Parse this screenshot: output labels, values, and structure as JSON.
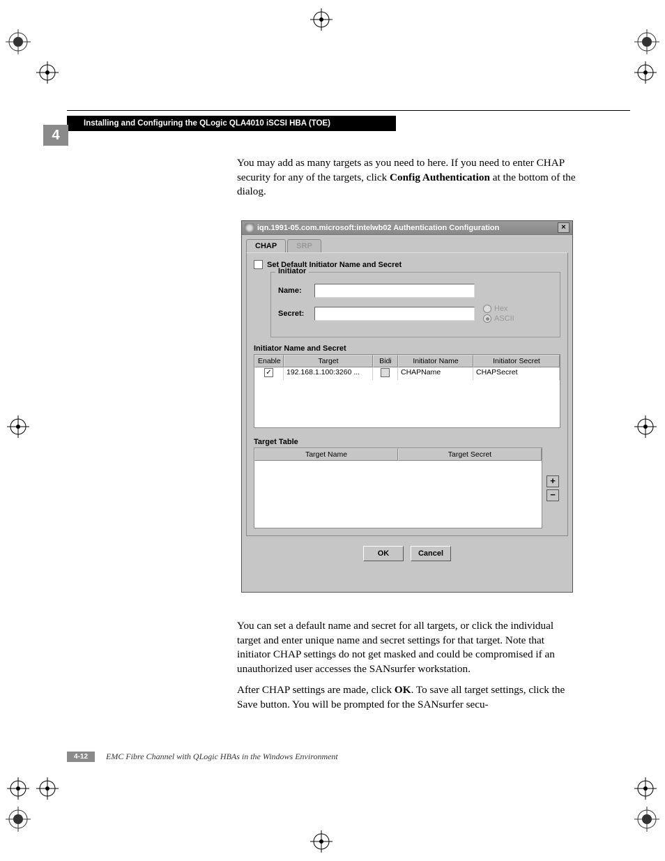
{
  "chapter_num": "4",
  "header_title": "Installing and Configuring the QLogic QLA4010 iSCSI HBA (TOE)",
  "para1_a": "You may add as many targets as you need to here.  If you need to enter CHAP security for any of the targets, click ",
  "para1_b": "Config Authentication",
  "para1_c": " at the bottom of the dialog.",
  "dialog": {
    "title": "iqn.1991-05.com.microsoft:intelwb02 Authentication Configuration",
    "tab_chap": "CHAP",
    "tab_srp": "SRP",
    "set_default_label": "Set Default Initiator Name and Secret",
    "initiator_legend": "Initiator",
    "name_label": "Name:",
    "secret_label": "Secret:",
    "radio_hex": "Hex",
    "radio_ascii": "ASCII",
    "initiator_table_label": "Initiator Name and Secret",
    "init_cols": {
      "enable": "Enable",
      "target": "Target",
      "bidi": "Bidi",
      "initiator_name": "Initiator Name",
      "initiator_secret": "Initiator Secret"
    },
    "init_row": {
      "enable_checked": true,
      "target": "192.168.1.100:3260 ...",
      "bidi_checked": false,
      "initiator_name": "CHAPName",
      "initiator_secret": "CHAPSecret"
    },
    "target_table_label": "Target Table",
    "target_cols": {
      "name": "Target Name",
      "secret": "Target Secret"
    },
    "plus": "+",
    "minus": "−",
    "ok": "OK",
    "cancel": "Cancel",
    "close": "×"
  },
  "para2": "You can set a default name and secret for all targets, or click the individual target and enter unique name and secret settings for that target.  Note that initiator CHAP settings do not get masked and could be compromised if an unauthorized user accesses the SANsurfer workstation.",
  "para3_a": "After CHAP settings are made, click ",
  "para3_b": "OK",
  "para3_c": ".  To save all target settings, click the Save button.  You will be prompted for the SANsurfer secu-",
  "page_num": "4-12",
  "footer_title": "EMC Fibre Channel with QLogic HBAs in the Windows Environment"
}
